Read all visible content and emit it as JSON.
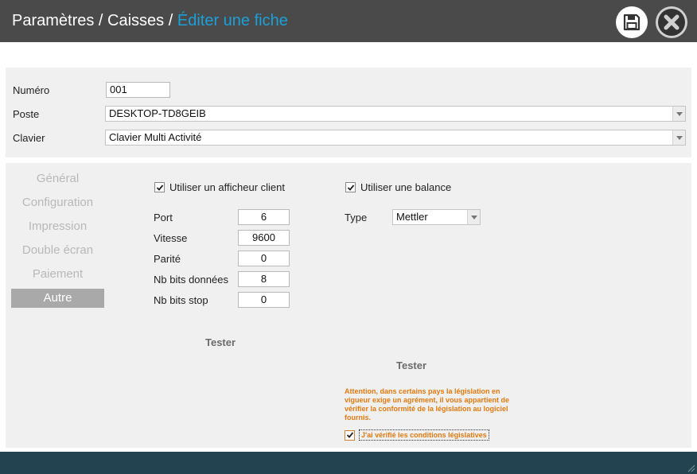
{
  "header": {
    "crumb1": "Paramètres",
    "sep1": " / ",
    "crumb2": "Caisses",
    "sep2": " / ",
    "current": "Éditer une fiche",
    "save_icon": "floppy-disk-icon",
    "close_icon": "close-x-icon",
    "accent_color": "#1ba0d8"
  },
  "form": {
    "numero": {
      "label": "Numéro",
      "value": "001"
    },
    "poste": {
      "label": "Poste",
      "value": "DESKTOP-TD8GEIB"
    },
    "clavier": {
      "label": "Clavier",
      "value": "Clavier Multi Activité"
    }
  },
  "nav": {
    "items": [
      "Général",
      "Configuration",
      "Impression",
      "Double écran",
      "Paiement",
      "Autre"
    ],
    "active": "Autre"
  },
  "afficheur": {
    "label": "Utiliser un afficheur client",
    "checked": true,
    "fields": [
      {
        "label": "Port",
        "value": "6"
      },
      {
        "label": "Vitesse",
        "value": "9600"
      },
      {
        "label": "Parité",
        "value": "0"
      },
      {
        "label": "Nb bits données",
        "value": "8"
      },
      {
        "label": "Nb bits stop",
        "value": "0"
      }
    ],
    "test_label": "Tester"
  },
  "balance": {
    "label": "Utiliser une balance",
    "checked": true,
    "type_label": "Type",
    "type_value": "Mettler",
    "test_label": "Tester",
    "warning": "Attention, dans certains pays la législation en vigueur exige un agrément, il vous appartient de vérifier la conformité de la législation au logiciel fournis.",
    "legal_label": "J'ai vérifié les conditions législatives",
    "legal_checked": true,
    "warning_color": "#e07a10"
  },
  "footer": {
    "color": "#22434f"
  }
}
